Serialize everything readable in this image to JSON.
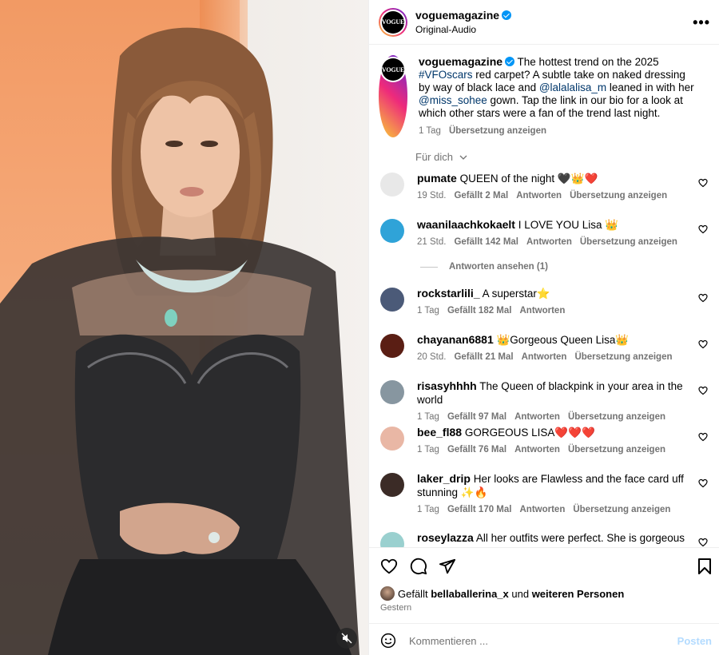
{
  "header": {
    "avatar_text": "VOGUE",
    "username": "voguemagazine",
    "subtitle": "Original-Audio",
    "more_icon": "more-horizontal-icon"
  },
  "caption": {
    "username": "voguemagazine",
    "text_1": "The hottest trend on the 2025 ",
    "hashtag": "#VFOscars",
    "text_2": " red carpet? A subtle take on naked dressing by way of black lace and ",
    "mention_1": "@lalalalisa_m",
    "text_3": " leaned in with her ",
    "mention_2": "@miss_sohee",
    "text_4": " gown. Tap the link in our bio for a look at which other stars were a fan of the trend last night.",
    "time": "1 Tag",
    "translate": "Übersetzung anzeigen"
  },
  "sort_label": "Für dich",
  "comments": [
    {
      "user": "pumate",
      "text": "QUEEN of the night 🖤👑❤️",
      "time": "19 Std.",
      "likes": "Gefällt 2 Mal",
      "reply": "Antworten",
      "translate": "Übersetzung anzeigen",
      "avatar_color": "#e8e8e8"
    },
    {
      "user": "waanilaachkokaelt",
      "text": "I LOVE YOU Lisa 👑",
      "time": "21 Std.",
      "likes": "Gefällt 142 Mal",
      "reply": "Antworten",
      "translate": "Übersetzung anzeigen",
      "avatar_color": "#2fa3d8"
    },
    {
      "user": "rockstarlili_",
      "text": "A superstar⭐",
      "time": "1 Tag",
      "likes": "Gefällt 182 Mal",
      "reply": "Antworten",
      "translate": "",
      "avatar_color": "#4b5a78"
    },
    {
      "user": "chayanan6881",
      "text": "👑Gorgeous Queen Lisa👑",
      "time": "20 Std.",
      "likes": "Gefällt 21 Mal",
      "reply": "Antworten",
      "translate": "Übersetzung anzeigen",
      "avatar_color": "#5a1e14"
    },
    {
      "user": "risasyhhhh",
      "text": "The Queen of blackpink in your area in the world",
      "time": "1 Tag",
      "likes": "Gefällt 97 Mal",
      "reply": "Antworten",
      "translate": "Übersetzung anzeigen",
      "avatar_color": "#8796a0"
    },
    {
      "user": "bee_fl88",
      "text": "GORGEOUS LISA❤️❤️❤️",
      "time": "1 Tag",
      "likes": "Gefällt 76 Mal",
      "reply": "Antworten",
      "translate": "Übersetzung anzeigen",
      "avatar_color": "#e9b7a5"
    },
    {
      "user": "laker_drip",
      "text": "Her looks are Flawless and the face card uff stunning ✨🔥",
      "time": "1 Tag",
      "likes": "Gefällt 170 Mal",
      "reply": "Antworten",
      "translate": "Übersetzung anzeigen",
      "avatar_color": "#3b2b26"
    },
    {
      "user": "roseylazza",
      "text": "All her outfits were perfect. She is gorgeous",
      "time": "",
      "likes": "",
      "reply": "",
      "translate": "",
      "avatar_color": "#9ad0cf"
    }
  ],
  "view_replies": "Antworten ansehen (1)",
  "likes_bar": {
    "prefix": "Gefällt ",
    "user": "bellaballerina_x",
    "middle": " und ",
    "others": "weiteren Personen",
    "date": "Gestern"
  },
  "composer": {
    "placeholder": "Kommentieren ...",
    "post_label": "Posten"
  },
  "colors": {
    "link": "#00376b",
    "meta": "#737373",
    "verified": "#0095f6",
    "post_disabled": "#b3dbff"
  }
}
